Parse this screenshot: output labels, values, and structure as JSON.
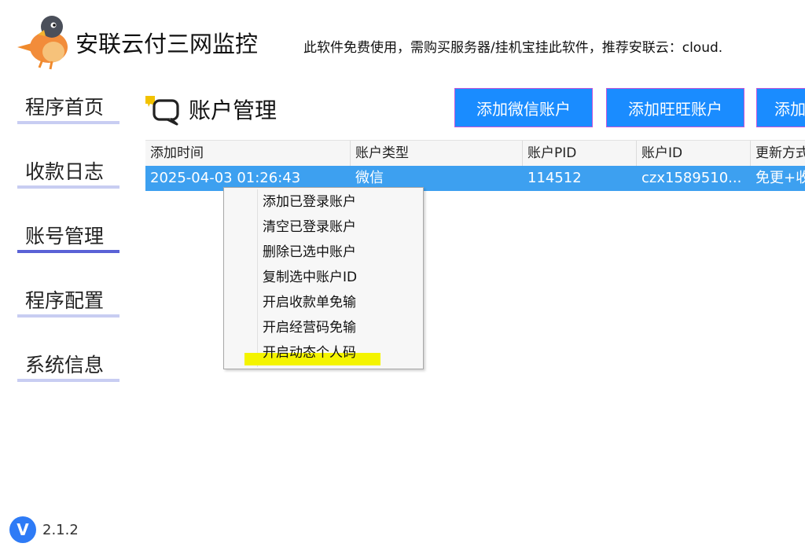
{
  "header": {
    "app_title": "安联云付三网监控",
    "notice": "此软件免费使用，需购买服务器/挂机宝挂此软件，推荐安联云：cloud."
  },
  "sidebar": {
    "items": [
      {
        "label": "程序首页",
        "active": false
      },
      {
        "label": "收款日志",
        "active": false
      },
      {
        "label": "账号管理",
        "active": true
      },
      {
        "label": "程序配置",
        "active": false
      },
      {
        "label": "系统信息",
        "active": false
      }
    ]
  },
  "version": {
    "badge": "V",
    "number": "2.1.2"
  },
  "page": {
    "title": "账户管理"
  },
  "toolbar": {
    "buttons": [
      "添加微信账户",
      "添加旺旺账户",
      "添加"
    ]
  },
  "table": {
    "columns": [
      "添加时间",
      "账户类型",
      "账户PID",
      "账户ID",
      "更新方式"
    ],
    "rows": [
      {
        "time": "2025-04-03 01:26:43",
        "type": "微信",
        "pid": "114512",
        "account_id": "czx1589510...",
        "update": "免更+收"
      }
    ]
  },
  "context_menu": {
    "items": [
      "添加已登录账户",
      "清空已登录账户",
      "删除已选中账户",
      "复制选中账户ID",
      "开启收款单免输",
      "开启经营码免输",
      "开启动态个人码"
    ]
  },
  "colors": {
    "button_blue": "#1a8cff",
    "row_selected": "#3da0f0",
    "nav_underline": "#c8cdf2",
    "nav_active_underline": "#5a62d6",
    "highlight": "#f4f400"
  }
}
